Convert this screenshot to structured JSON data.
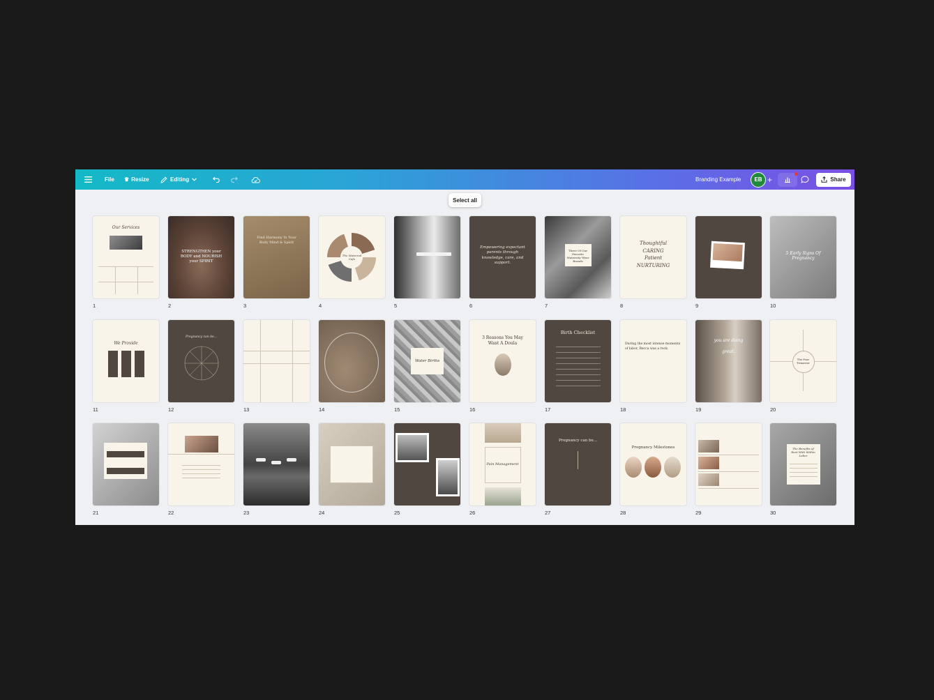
{
  "topbar": {
    "file": "File",
    "resize": "Resize",
    "editing": "Editing",
    "title": "Branding Example",
    "avatar": "EB",
    "share": "Share"
  },
  "select_all": "Select all",
  "colors": {
    "accent_start": "#14b9c6",
    "accent_end": "#7a4fe3",
    "brown": "#4f4740",
    "cream": "#f8f4ea"
  },
  "pages": [
    {
      "n": "1",
      "style": "cream",
      "text": "Our Services"
    },
    {
      "n": "2",
      "style": "photo-warm",
      "text": "STRENGTHEN your BODY and NOURISH your SPIRIT"
    },
    {
      "n": "3",
      "style": "photo-tan",
      "text": "Find Harmony In Your Body Mind & Spirit"
    },
    {
      "n": "4",
      "style": "cream-circle",
      "text": "The Maternal Cafe"
    },
    {
      "n": "5",
      "style": "photo-gray",
      "text": ""
    },
    {
      "n": "6",
      "style": "brown",
      "text": "Empowering expectant parents through knowledge, care, and support."
    },
    {
      "n": "7",
      "style": "photo-gray",
      "text": "Three Of Our Favorite Maternity Wear Brands"
    },
    {
      "n": "8",
      "style": "cream",
      "text": "Thoughtful CARING Patient NURTURING"
    },
    {
      "n": "9",
      "style": "brown-photo",
      "text": ""
    },
    {
      "n": "10",
      "style": "photo-gray",
      "text": "5 Early Signs Of Pregnancy"
    },
    {
      "n": "11",
      "style": "cream",
      "text": "We Provide"
    },
    {
      "n": "12",
      "style": "brown-wheel",
      "text": "Pregnancy can be..."
    },
    {
      "n": "13",
      "style": "cream-grid",
      "text": ""
    },
    {
      "n": "14",
      "style": "photo-tan",
      "text": ""
    },
    {
      "n": "15",
      "style": "photo-marble",
      "text": "Water Births"
    },
    {
      "n": "16",
      "style": "cream",
      "text": "3 Reasons You May Want A Doula"
    },
    {
      "n": "17",
      "style": "brown",
      "text": "Birth Checklist"
    },
    {
      "n": "18",
      "style": "cream-text",
      "text": "During the most intense moments of labor, Becca was a rock."
    },
    {
      "n": "19",
      "style": "photo-gray",
      "text": "you are doing great."
    },
    {
      "n": "20",
      "style": "cream-diagram",
      "text": "The Four Trimester"
    },
    {
      "n": "21",
      "style": "photo-gray",
      "text": ""
    },
    {
      "n": "22",
      "style": "cream",
      "text": ""
    },
    {
      "n": "23",
      "style": "photo-sea",
      "text": ""
    },
    {
      "n": "24",
      "style": "photo-tan-light",
      "text": ""
    },
    {
      "n": "25",
      "style": "brown-photos",
      "text": ""
    },
    {
      "n": "26",
      "style": "cream",
      "text": "Pain Management"
    },
    {
      "n": "27",
      "style": "brown",
      "text": "Pregnancy can be..."
    },
    {
      "n": "28",
      "style": "cream",
      "text": "Pregnancy Milestones"
    },
    {
      "n": "29",
      "style": "cream-list",
      "text": ""
    },
    {
      "n": "30",
      "style": "photo-gray",
      "text": "The Benefits of Rest With Within Labor"
    }
  ]
}
